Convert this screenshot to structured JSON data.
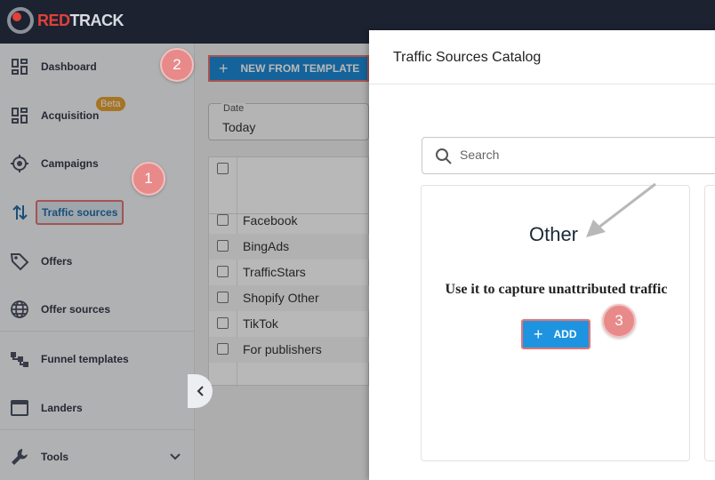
{
  "app": {
    "logo_red": "RED",
    "logo_white": "TRACK"
  },
  "sidebar": {
    "items": [
      {
        "label": "Dashboard",
        "icon": "dashboard-icon"
      },
      {
        "label": "Acquisition",
        "icon": "acquisition-icon",
        "badge": "Beta"
      },
      {
        "label": "Campaigns",
        "icon": "campaigns-icon"
      },
      {
        "label": "Traffic sources",
        "icon": "traffic-sources-icon"
      },
      {
        "label": "Offers",
        "icon": "offers-icon"
      },
      {
        "label": "Offer sources",
        "icon": "globe-icon"
      },
      {
        "label": "Funnel templates",
        "icon": "funnel-icon"
      },
      {
        "label": "Landers",
        "icon": "landers-icon"
      },
      {
        "label": "Tools",
        "icon": "wrench-icon"
      }
    ]
  },
  "main": {
    "template_button": "NEW FROM TEMPLATE",
    "date_label": "Date",
    "date_value": "Today",
    "rows": [
      "Facebook",
      "BingAds",
      "TrafficStars",
      "Shopify Other",
      "TikTok",
      "For publishers"
    ]
  },
  "modal": {
    "title": "Traffic Sources Catalog",
    "search_placeholder": "Search",
    "card": {
      "title": "Other",
      "description": "Use it to capture unattributed traffic",
      "add_label": "ADD"
    }
  },
  "steps": [
    "1",
    "2",
    "3"
  ],
  "colors": {
    "accent": "#1e94e0",
    "step_badge": "#e88a8a",
    "brand_red": "#e0413a",
    "topbar": "#1d2231"
  }
}
